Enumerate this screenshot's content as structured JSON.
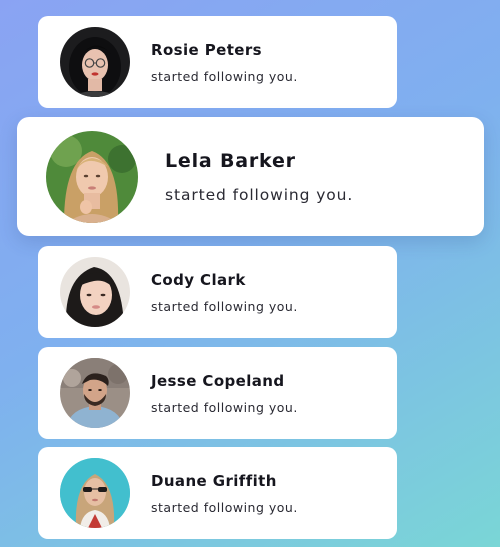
{
  "notifications": [
    {
      "name": "Rosie Peters",
      "message": "started following you.",
      "avatar_icon": "avatar-rosie-peters",
      "highlighted": false
    },
    {
      "name": "Lela Barker",
      "message": "started following you.",
      "avatar_icon": "avatar-lela-barker",
      "highlighted": true
    },
    {
      "name": "Cody Clark",
      "message": "started following you.",
      "avatar_icon": "avatar-cody-clark",
      "highlighted": false
    },
    {
      "name": "Jesse Copeland",
      "message": "started following you.",
      "avatar_icon": "avatar-jesse-copeland",
      "highlighted": false
    },
    {
      "name": "Duane Griffith",
      "message": "started following you.",
      "avatar_icon": "avatar-duane-griffith",
      "highlighted": false
    }
  ],
  "colors": {
    "background_start": "#8aa3f3",
    "background_end": "#7ad6d6",
    "card": "#ffffff",
    "name_text": "#16161e"
  }
}
